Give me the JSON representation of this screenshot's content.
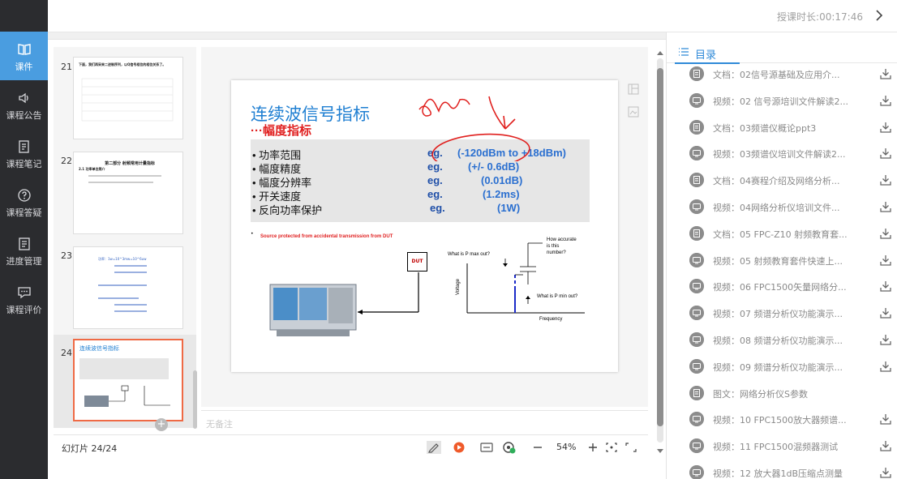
{
  "nav": {
    "items": [
      {
        "label": "课件",
        "icon": "book-icon",
        "active": true
      },
      {
        "label": "课程公告",
        "icon": "speaker-icon",
        "active": false
      },
      {
        "label": "课程笔记",
        "icon": "note-icon",
        "active": false
      },
      {
        "label": "课程答疑",
        "icon": "question-icon",
        "active": false
      },
      {
        "label": "进度管理",
        "icon": "progress-icon",
        "active": false
      },
      {
        "label": "课程评价",
        "icon": "comment-icon",
        "active": false
      }
    ]
  },
  "header": {
    "duration": "授课时长:00:17:46"
  },
  "thumbnails": [
    {
      "num": "21",
      "title": "下面，我们再采来二进制序列，以Q信号相位的相位关系了。"
    },
    {
      "num": "22",
      "title": "第二部分 射频常用计量指标",
      "subtitle": "2.1 功率单位简介"
    },
    {
      "num": "23",
      "title": "功率：1w=10^3mw=10^6uw"
    },
    {
      "num": "24",
      "title": "连续波信号指标",
      "selected": true
    }
  ],
  "slide": {
    "title": "连续波信号指标",
    "subtitle": "···幅度指标",
    "bullets": [
      {
        "label": "功率范围",
        "eg": "eg.",
        "value": "(-120dBm to +18dBm)"
      },
      {
        "label": "幅度精度",
        "eg": "eg.",
        "value": "(+/- 0.6dB)"
      },
      {
        "label": "幅度分辨率",
        "eg": "eg.",
        "value": "(0.01dB)"
      },
      {
        "label": "开关速度",
        "eg": "eg.",
        "value": "(1.2ms)"
      },
      {
        "label": "反向功率保护",
        "eg": "eg.",
        "value": "(1W)"
      }
    ],
    "note": "Source protected from accidental transmission from DUT",
    "dut": "DUT",
    "q1": [
      "How accurate",
      "is this",
      "number?"
    ],
    "pmax": "What is P max out?",
    "pmin": "What is P min out?",
    "ylabel": "Voltage",
    "xlabel": "Frequency",
    "handwriting": "dBm"
  },
  "notes": {
    "placeholder": "无备注"
  },
  "bottom": {
    "slide_count": "幻灯片 24/24",
    "zoom": "54%"
  },
  "catalog": {
    "title": "目录",
    "items": [
      {
        "text": "文档：02信号源基础及应用介...",
        "download": true
      },
      {
        "text": "视频：02 信号源培训文件解读2...",
        "download": true
      },
      {
        "text": "文档：03频谱仪概论ppt3",
        "download": true
      },
      {
        "text": "视频：03频谱仪培训文件解读2...",
        "download": true
      },
      {
        "text": "文档：04赛程介绍及网络分析...",
        "download": true
      },
      {
        "text": "视频：04网络分析仪培训文件...",
        "download": true
      },
      {
        "text": "文档：05 FPC-Z10 射频教育套...",
        "download": true
      },
      {
        "text": "视频：05 射频教育套件快速上...",
        "download": true
      },
      {
        "text": "视频：06 FPC1500矢量网络分...",
        "download": true
      },
      {
        "text": "视频：07 频谱分析仪功能演示...",
        "download": true
      },
      {
        "text": "视频：08 频谱分析仪功能演示...",
        "download": true
      },
      {
        "text": "视频：09 频谱分析仪功能演示...",
        "download": true
      },
      {
        "text": "图文：网络分析仪S参数",
        "download": false
      },
      {
        "text": "视频：10 FPC1500放大器频谱...",
        "download": true
      },
      {
        "text": "视频：11 FPC1500混频器测试",
        "download": true
      },
      {
        "text": "视频：12 放大器1dB压缩点测量",
        "download": true
      }
    ]
  },
  "colors": {
    "accent": "#4a9de0",
    "slide_title": "#1f7fd2",
    "slide_sub": "#e02020",
    "selected_border": "#ef6a45"
  }
}
